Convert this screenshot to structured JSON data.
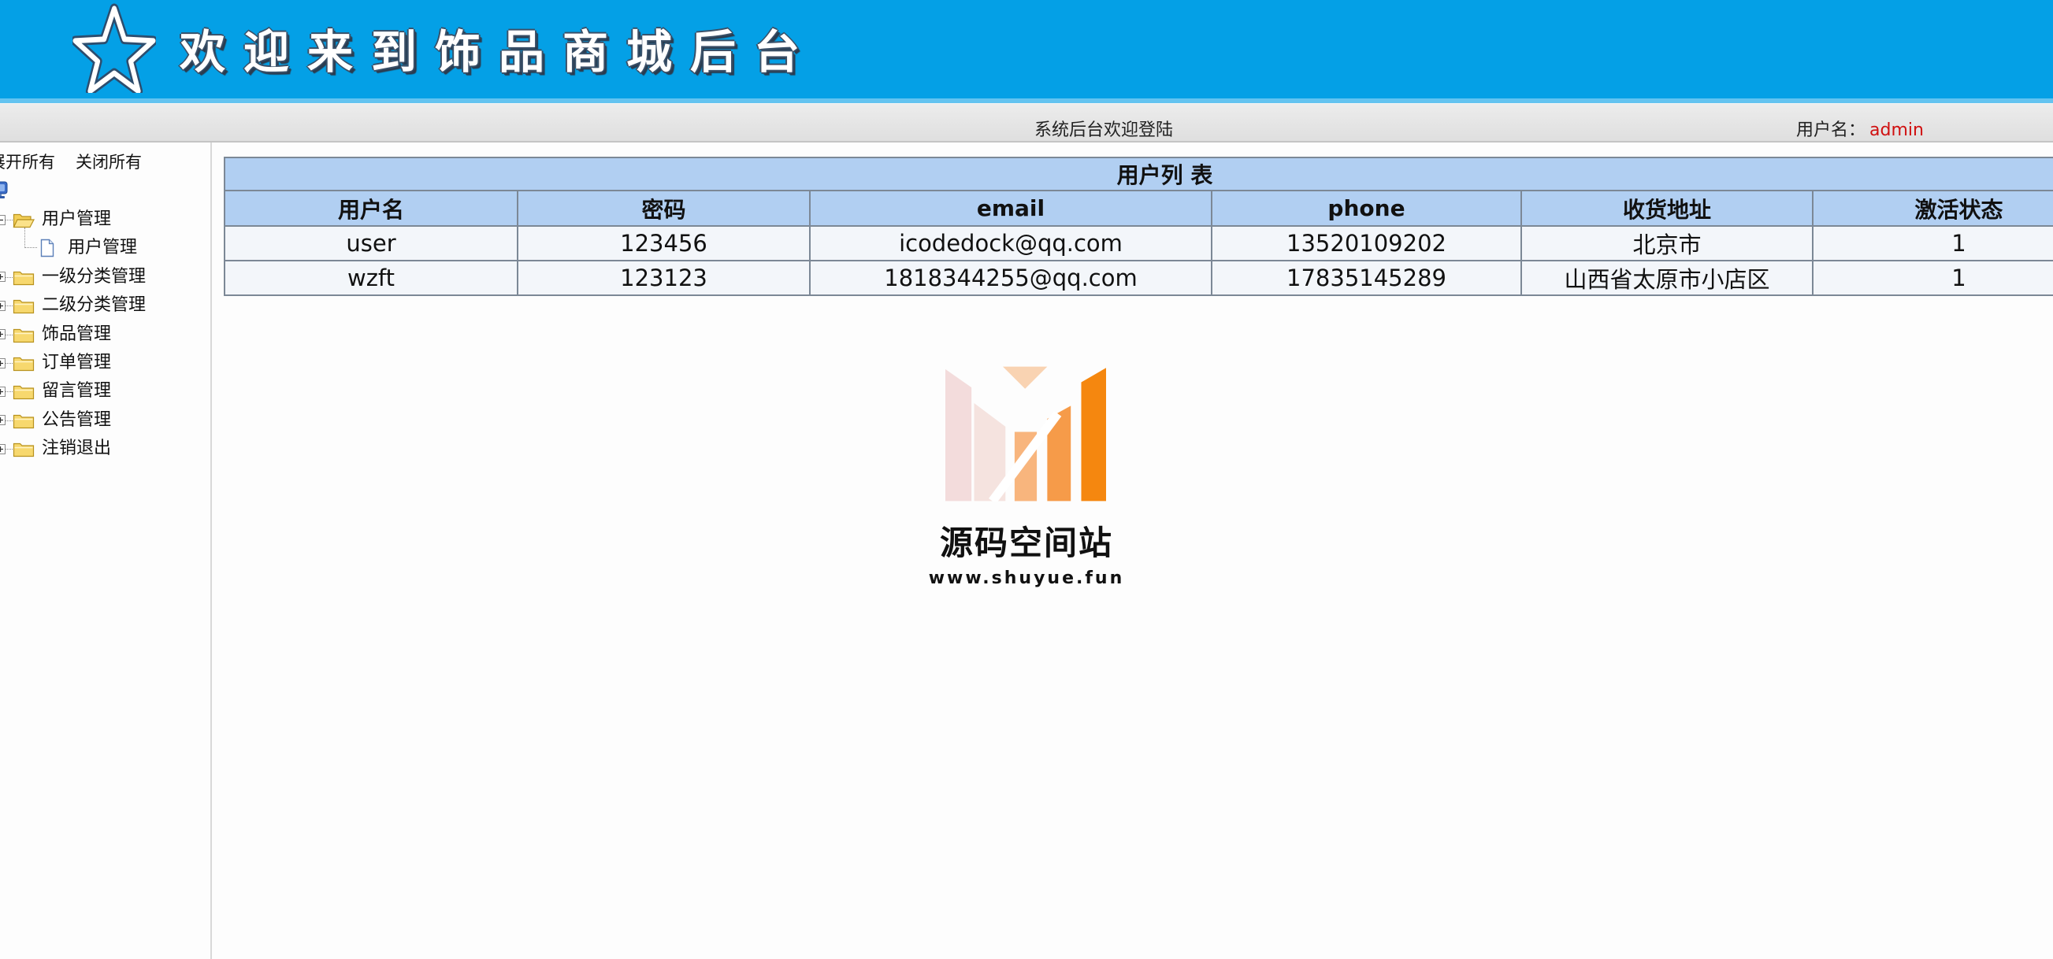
{
  "header": {
    "title": "欢迎来到饰品商城后台",
    "logo_icon": "star-icon"
  },
  "topbar": {
    "welcome": "系统后台欢迎登陆",
    "user_label": "用户名：",
    "username": "admin"
  },
  "sidebar": {
    "expand_all": "展开所有",
    "collapse_all": "关闭所有",
    "root_icon": "computer-icon",
    "items": [
      {
        "label": "用户管理",
        "icon": "folder-open-icon",
        "expanded": true,
        "children": [
          {
            "label": "用户管理",
            "icon": "document-icon"
          }
        ]
      },
      {
        "label": "一级分类管理",
        "icon": "folder-icon",
        "expanded": false
      },
      {
        "label": "二级分类管理",
        "icon": "folder-icon",
        "expanded": false
      },
      {
        "label": "饰品管理",
        "icon": "folder-icon",
        "expanded": false
      },
      {
        "label": "订单管理",
        "icon": "folder-icon",
        "expanded": false
      },
      {
        "label": "留言管理",
        "icon": "folder-icon",
        "expanded": false
      },
      {
        "label": "公告管理",
        "icon": "folder-icon",
        "expanded": false
      },
      {
        "label": "注销退出",
        "icon": "folder-icon",
        "expanded": false
      }
    ]
  },
  "user_table": {
    "title": "用户列 表",
    "columns": [
      "用户名",
      "密码",
      "email",
      "phone",
      "收货地址",
      "激活状态"
    ],
    "rows": [
      [
        "user",
        "123456",
        "icodedock@qq.com",
        "13520109202",
        "北京市",
        "1"
      ],
      [
        "wzft",
        "123123",
        "1818344255@qq.com",
        "17835145289",
        "山西省太原市小店区",
        "1"
      ]
    ]
  },
  "watermark": {
    "name": "源码空间站",
    "url": "www.shuyue.fun"
  },
  "colors": {
    "header_blue": "#04a0e6",
    "table_header_bg": "#b1cff2",
    "username_red": "#d01010"
  }
}
